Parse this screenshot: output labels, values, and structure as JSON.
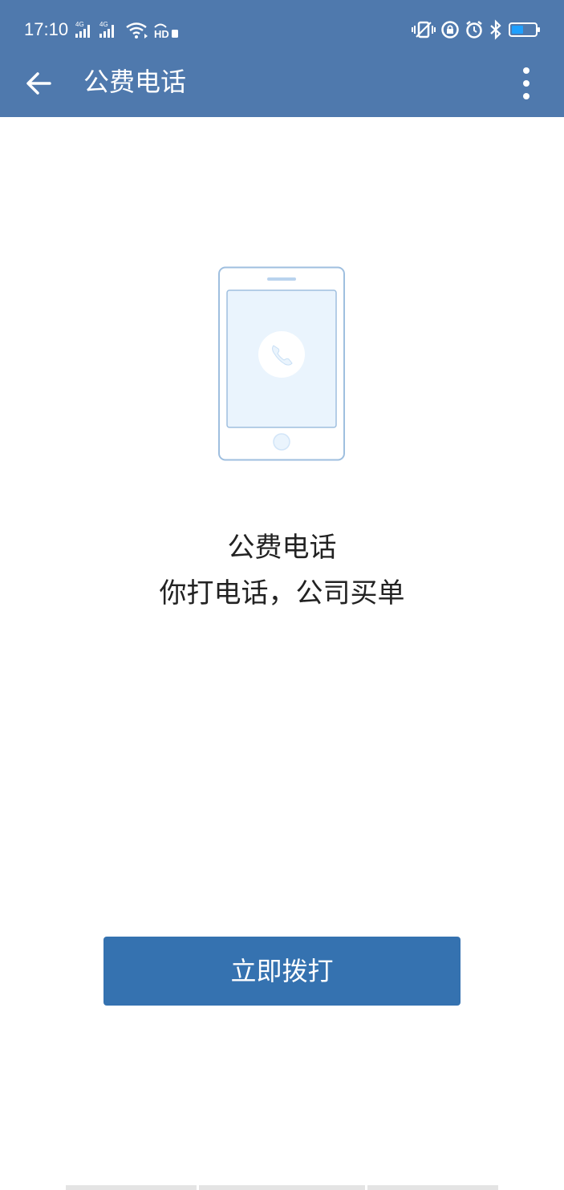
{
  "status_bar": {
    "time": "17:10",
    "network_labels": [
      "4G",
      "4G"
    ],
    "hd_label": "HD"
  },
  "app_bar": {
    "title": "公费电话",
    "back_icon": "arrow-back-icon",
    "menu_icon": "more-vert-icon"
  },
  "content": {
    "illustration_icon": "phone-call-icon",
    "headline": "公费电话",
    "subline": "你打电话，公司买单"
  },
  "action": {
    "call_button_label": "立即拨打"
  },
  "colors": {
    "app_bar": "#4f79ad",
    "button": "#3572b0",
    "illustration_stroke": "#9fbfdf",
    "illustration_fill": "#eaf4fd"
  }
}
